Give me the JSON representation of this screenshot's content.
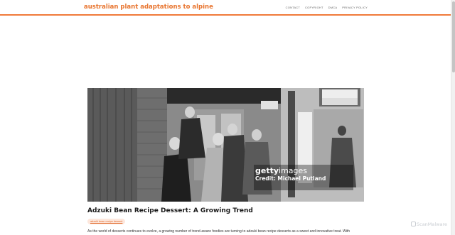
{
  "header": {
    "site_title": "australian plant adaptations to alpine",
    "nav": [
      "CONTACT",
      "COPYRIGHT",
      "DMCA",
      "PRIVACY POLICY"
    ],
    "accent_color": "#f07a3a"
  },
  "hero": {
    "watermark_brand_bold": "getty",
    "watermark_brand_light": "images",
    "watermark_credit": "Credit: Michael Putland"
  },
  "post": {
    "title": "Adzuki Bean Recipe Dessert: A Growing Trend",
    "tag": "adzuki bean recipe dessert",
    "intro": "As the world of desserts continues to evolve, a growing number of trend-aware foodies are turning to adzuki bean recipe desserts as a sweet and innovative treat. With"
  },
  "badge": {
    "label": "ScanMalware",
    "icon": "scanmalware-icon"
  }
}
